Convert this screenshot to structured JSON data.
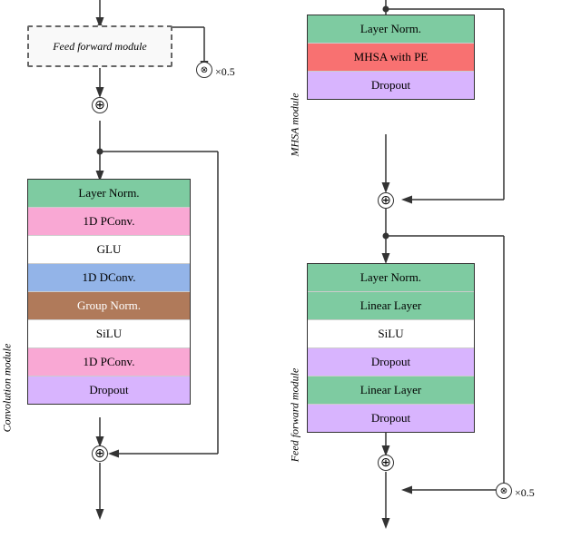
{
  "left_module": {
    "label": "Convolution module",
    "ff_box_label": "Feed forward module",
    "layers": [
      {
        "text": "Layer Norm.",
        "bg": "green"
      },
      {
        "text": "1D PConv.",
        "bg": "pink"
      },
      {
        "text": "GLU",
        "bg": "white"
      },
      {
        "text": "1D DConv.",
        "bg": "blue"
      },
      {
        "text": "Group Norm.",
        "bg": "brown"
      },
      {
        "text": "SiLU",
        "bg": "white"
      },
      {
        "text": "1D PConv.",
        "bg": "pink"
      },
      {
        "text": "Dropout",
        "bg": "lavender"
      }
    ]
  },
  "mhsa_module": {
    "label": "MHSA module",
    "layers": [
      {
        "text": "Layer Norm.",
        "bg": "green"
      },
      {
        "text": "MHSA with PE",
        "bg": "salmon"
      },
      {
        "text": "Dropout",
        "bg": "lavender"
      }
    ]
  },
  "ff_right_module": {
    "label": "Feed forward module",
    "layers": [
      {
        "text": "Layer Norm.",
        "bg": "green"
      },
      {
        "text": "Linear Layer",
        "bg": "green"
      },
      {
        "text": "SiLU",
        "bg": "white"
      },
      {
        "text": "Dropout",
        "bg": "lavender"
      },
      {
        "text": "Linear Layer",
        "bg": "green"
      },
      {
        "text": "Dropout",
        "bg": "lavender"
      }
    ]
  },
  "scale_labels": [
    "×0.5",
    "×0.5"
  ]
}
